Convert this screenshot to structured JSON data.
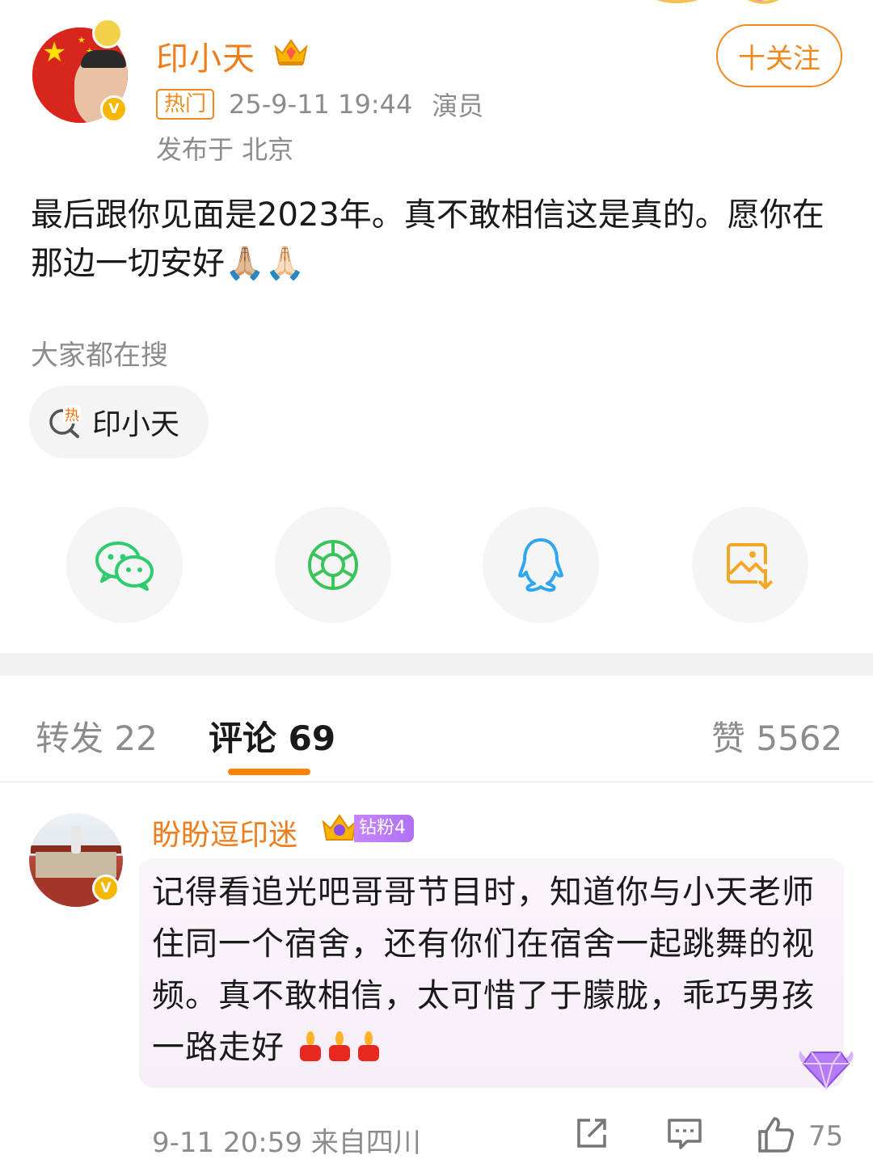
{
  "post": {
    "username": "印小天",
    "hot_badge": "热门",
    "timestamp": "25-9-11 19:44",
    "role": "演员",
    "location": "发布于 北京",
    "follow_label": "十关注",
    "text": "最后跟你见面是2023年。真不敢相信这是真的。愿你在那边一切安好",
    "emoji_pray": "🙏🏼🙏🏻"
  },
  "search": {
    "title": "大家都在搜",
    "chip_label": "印小天",
    "hot_char": "热"
  },
  "share": {
    "items": [
      "wechat-icon",
      "moments-icon",
      "qq-icon",
      "save-image-icon"
    ],
    "colors": {
      "wechat": "#2ecb6f",
      "moments": "#3bc45a",
      "qq": "#2fa7f0",
      "save": "#f5a623"
    }
  },
  "tabs": {
    "repost": "转发 22",
    "comment": "评论 69",
    "like": "赞 5562"
  },
  "comment": {
    "username": "盼盼逗印迷",
    "fan_badge": "钻粉4",
    "text": "记得看追光吧哥哥节目时，知道你与小天老师住同一个宿舍，还有你们在宿舍一起跳舞的视频。真不敢相信，太可惜了于朦胧，乖巧男孩一路走好",
    "meta": "9-11 20:59  来自四川",
    "like_count": "75"
  },
  "colors": {
    "accent": "#f07d1c",
    "tab_underline": "#ff8200",
    "meta_gray": "#8c8c8c"
  }
}
